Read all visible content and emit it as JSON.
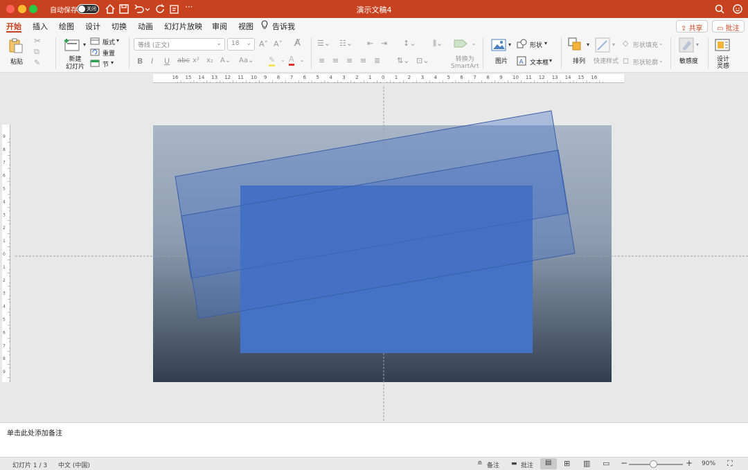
{
  "window": {
    "title": "演示文稿4",
    "autosave_label": "自动保存",
    "autosave_state": "关闭"
  },
  "tabs": [
    "开始",
    "插入",
    "绘图",
    "设计",
    "切换",
    "动画",
    "幻灯片放映",
    "审阅",
    "视图"
  ],
  "tell_me": "告诉我",
  "share_label": "共享",
  "comments_label": "批注",
  "ribbon": {
    "paste": "粘贴",
    "new_slide": "新建\n幻灯片",
    "new_slide_line1": "新建",
    "new_slide_line2": "幻灯片",
    "layout": "版式",
    "reset": "重置",
    "section": "节",
    "font_name": "等线 (正文)",
    "font_size": "18",
    "convert_line1": "转换为",
    "convert_line2": "SmartArt",
    "picture": "图片",
    "shape": "形状",
    "textbox": "文本框",
    "arrange": "排列",
    "quick_styles": "快速样式",
    "shape_fill": "形状填充",
    "shape_outline": "形状轮廓",
    "sensitivity": "敏感度",
    "designer_line1": "设计",
    "designer_line2": "灵感"
  },
  "notes_placeholder": "单击此处添加备注",
  "status": {
    "slide_info": "幻灯片 1 / 3",
    "language": "中文 (中国)",
    "notes": "备注",
    "comments": "批注",
    "zoom": "90%"
  },
  "colors": {
    "accent": "#c9421f",
    "slide_gradient_top": "#a9b6c8",
    "slide_gradient_bottom": "#323e4f",
    "shape_fill": "#4472c4"
  }
}
